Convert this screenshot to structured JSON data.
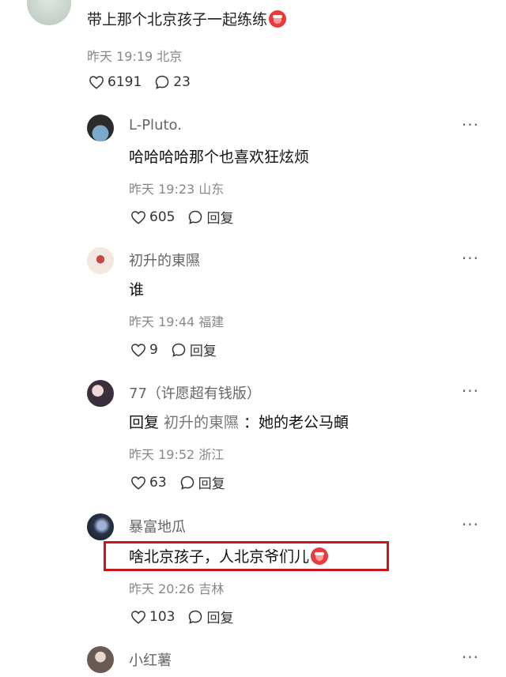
{
  "post": {
    "text": "带上那个北京孩子一起练练",
    "time": "昨天 19:19",
    "location": "北京",
    "likes": "6191",
    "comments": "23"
  },
  "comments": [
    {
      "username": "L-Pluto.",
      "text": "哈哈哈哈那个也喜欢狂炫烦",
      "time": "昨天 19:23",
      "location": "山东",
      "likes": "605",
      "reply_label": "回复"
    },
    {
      "username": "初升的東隰",
      "text": "谁",
      "time": "昨天 19:44",
      "location": "福建",
      "likes": "9",
      "reply_label": "回复"
    },
    {
      "username": "77（许愿超有钱版）",
      "reply_prefix": "回复",
      "reply_to": "初升的東隰",
      "text": "：她的老公马頔",
      "time": "昨天 19:52",
      "location": "浙江",
      "likes": "63",
      "reply_label": "回复"
    },
    {
      "username": "暴富地瓜",
      "text": "啥北京孩子，人北京爷们儿",
      "time": "昨天 20:26",
      "location": "吉林",
      "likes": "103",
      "reply_label": "回复"
    },
    {
      "username": "小红薯"
    }
  ],
  "more_label": "···",
  "colors": {
    "highlight": "#c8171e"
  }
}
